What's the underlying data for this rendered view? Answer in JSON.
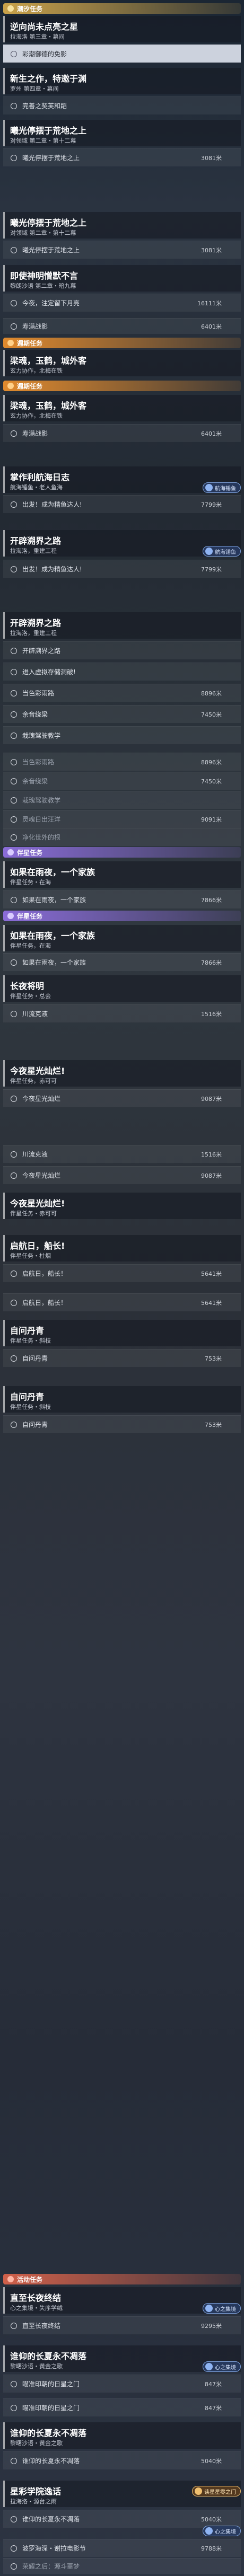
{
  "sections": [
    {
      "id": "s0",
      "title": "潮汐任务",
      "color": "gold"
    },
    {
      "id": "s1",
      "title": "週期任务",
      "color": "orange"
    },
    {
      "id": "s2",
      "title": "週期任务",
      "color": "orange"
    },
    {
      "id": "s3",
      "title": "伴星任务",
      "color": "purple"
    },
    {
      "id": "s4",
      "title": "伴星任务",
      "color": "purple"
    },
    {
      "id": "s5",
      "title": "活动任务",
      "color": "red"
    }
  ],
  "cards": [
    {
      "t": "逆向尚未点亮之星",
      "s": "拉海洛 第三章・幕间"
    },
    {
      "t": "新生之作，特邀于渊",
      "s": "罗州 第四章・幕间"
    },
    {
      "t": "曦光停摆于荒地之上",
      "s": "对领域 第二章・第十二幕"
    },
    {
      "t": "曦光停摆于荒地之上",
      "s": "对领域 第二章・第十二幕"
    },
    {
      "t": "即使神明憎默不言",
      "s": "黎朗沙语 第二章・暗九幕"
    },
    {
      "t": "梁魂，玉鹤，城外客",
      "s": "玄力协作，北梅在铁"
    },
    {
      "t": "梁魂，玉鹤，城外客",
      "s": "玄力协作，北梅在铁"
    },
    {
      "t": "掌作利航海日志",
      "s": "航海锤鱼・老人鱼海"
    },
    {
      "t": "开辟溯界之路",
      "s": "拉海洛，重建工程"
    },
    {
      "t": "开辟溯界之路",
      "s": "拉海洛，重建工程"
    },
    {
      "t": "如果在雨夜，一个家族",
      "s": "伴星任务・在海"
    },
    {
      "t": "如果在雨夜，一个家族",
      "s": "伴星任务，在海"
    },
    {
      "t": "长夜将明",
      "s": "伴星任务・总会"
    },
    {
      "t": "今夜星光灿烂!",
      "s": "伴星任务，赤可可"
    },
    {
      "t": "今夜星光灿烂!",
      "s": "伴星任务・赤可可"
    },
    {
      "t": "启航日，船长!",
      "s": "伴星任务・杜烟"
    },
    {
      "t": "自问丹青",
      "s": "伴星任务・斜枝"
    },
    {
      "t": "自问丹青",
      "s": "伴星任务・斜枝"
    },
    {
      "t": "直至长夜终结",
      "s": "心之集境・失序学绒"
    },
    {
      "t": "谁仰的长夏永不凋落",
      "s": "黎曙沙语・黄金之歌"
    },
    {
      "t": "谁仰的长夏永不凋落",
      "s": "黎曙沙语・黄金之歌"
    },
    {
      "t": "星彩学院逸话",
      "s": "拉海洛・源台之雨"
    }
  ],
  "rows": [
    {
      "text": "彩潮御德的免影",
      "val": ""
    },
    {
      "text": "完善之契芙和蹈",
      "val": ""
    },
    {
      "text": "曦光停摆于荒地之上",
      "val": "3081米"
    },
    {
      "text": "曦光停摆于荒地之上",
      "val": "3081米"
    },
    {
      "text": "今夜，注定留下月亮",
      "val": "16111米"
    },
    {
      "text": "寿满战影",
      "val": "6401米"
    },
    {
      "text": "寿满战影",
      "val": "6401米"
    },
    {
      "text": "出发！成为精鱼达人!",
      "val": "7799米"
    },
    {
      "text": "出发！成为精鱼达人!",
      "val": "7799米"
    },
    {
      "text": "开辟溯界之路",
      "val": ""
    },
    {
      "text": "进入虚拟存储洞破!",
      "val": ""
    },
    {
      "text": "当色彩雨路",
      "val": "8896米"
    },
    {
      "text": "余音绕梁",
      "val": "7450米"
    },
    {
      "text": "栽瑰驾驶教学",
      "val": ""
    },
    {
      "text": "当色彩雨路",
      "val": "8896米"
    },
    {
      "text": "余音绕梁",
      "val": "7450米"
    },
    {
      "text": "栽瑰驾驶教学",
      "val": ""
    },
    {
      "text": "灵魂日出汪洋",
      "val": "9091米"
    },
    {
      "text": "净化世外的根",
      "val": ""
    },
    {
      "text": "如果在雨夜，一个家族",
      "val": "7866米"
    },
    {
      "text": "如果在雨夜，一个家族",
      "val": "7866米"
    },
    {
      "text": "川流克液",
      "val": "1516米"
    },
    {
      "text": "今夜星光灿烂",
      "val": "9087米"
    },
    {
      "text": "川流克液",
      "val": "1516米"
    },
    {
      "text": "今夜星光灿烂",
      "val": "9087米"
    },
    {
      "text": "启航日，船长！",
      "val": "5641米"
    },
    {
      "text": "启航日，船长！",
      "val": "5641米"
    },
    {
      "text": "自问丹青",
      "val": "753米"
    },
    {
      "text": "自问丹青",
      "val": "753米"
    },
    {
      "text": "直至长夜终结",
      "val": "9295米"
    },
    {
      "text": "瞄准印朝的日星之门",
      "val": "847米"
    },
    {
      "text": "瞄准印朝的日星之门",
      "val": "847米"
    },
    {
      "text": "谁仰的长夏永不凋落",
      "val": "5040米"
    },
    {
      "text": "谁仰的长夏永不凋落",
      "val": "5040米"
    },
    {
      "text": "波罗海深・谢拉电影节",
      "val": "9788米"
    }
  ],
  "badges": {
    "fish": "航海锤鱼",
    "heart": "心之集境",
    "star": "读星星零之门"
  },
  "footer": {
    "text": "荣耀之后：源斗噩梦"
  }
}
